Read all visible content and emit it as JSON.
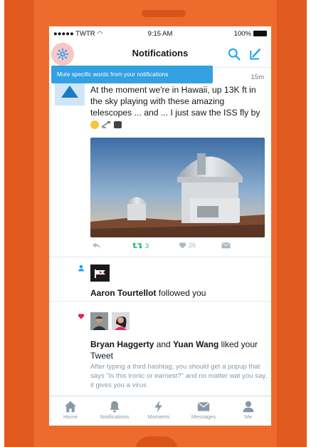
{
  "colors": {
    "phone": "#ee6b2e",
    "accent": "#33a1e2",
    "retweet": "#17bf63",
    "like": "#e0245e"
  },
  "status_bar": {
    "carrier": "TWTR",
    "time": "9:15 AM",
    "battery": "100%"
  },
  "nav": {
    "title": "Notifications",
    "left_icon": "gear-icon",
    "right_icons": [
      "search-icon",
      "compose-icon"
    ]
  },
  "tooltip": {
    "text": "Mute specific words from your notifications"
  },
  "tweet": {
    "time": "15m",
    "text": "At the moment we're in Hawaii, up 13K ft in the sky playing with these amazing telescopes ... and ... I just saw the ISS fly by",
    "retweets": "3",
    "likes": "26"
  },
  "follow": {
    "name": "Aaron Tourtellot",
    "action": " followed you"
  },
  "like_notification": {
    "name1": "Bryan Haggerty",
    "connector": " and ",
    "name2": "Yuan Wang",
    "action": " liked your Tweet",
    "tweet_text": "After typing a third hashtag, you should get a popup that says \"Is this ironic or earnest?\" and no matter wat you say, it gives you a virus"
  },
  "tabs": [
    {
      "label": "Home",
      "icon": "home-icon"
    },
    {
      "label": "Notifications",
      "icon": "bell-icon"
    },
    {
      "label": "Moments",
      "icon": "lightning-icon"
    },
    {
      "label": "Messages",
      "icon": "envelope-icon"
    },
    {
      "label": "Me",
      "icon": "person-icon"
    }
  ]
}
